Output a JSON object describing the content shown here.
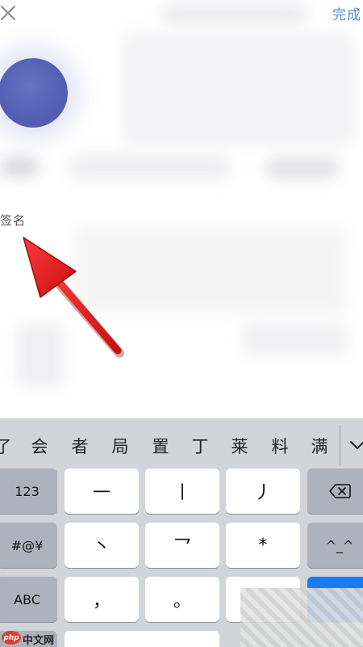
{
  "header": {
    "close_icon": "close-icon",
    "done_label": "完成",
    "accent_color": "#4f8fd0"
  },
  "profile": {
    "avatar_color": "#5460b4",
    "signature_label": "签名"
  },
  "annotation": {
    "arrow_color": "#e02020"
  },
  "keyboard": {
    "candidates": [
      "了",
      "会",
      "者",
      "局",
      "置",
      "丁",
      "莱",
      "料",
      "满"
    ],
    "expand_icon": "chevron-down-icon",
    "rows": [
      [
        "123",
        "一",
        "丨",
        "丿",
        "delete-icon"
      ],
      [
        "#@¥",
        "丶",
        "乛",
        "*",
        "^_^"
      ],
      [
        "ABC",
        "，",
        "。",
        "",
        ""
      ]
    ],
    "blue_key_color": "#1a7cf5"
  },
  "watermark": {
    "logo_text": "php",
    "site_text": "中文网"
  }
}
